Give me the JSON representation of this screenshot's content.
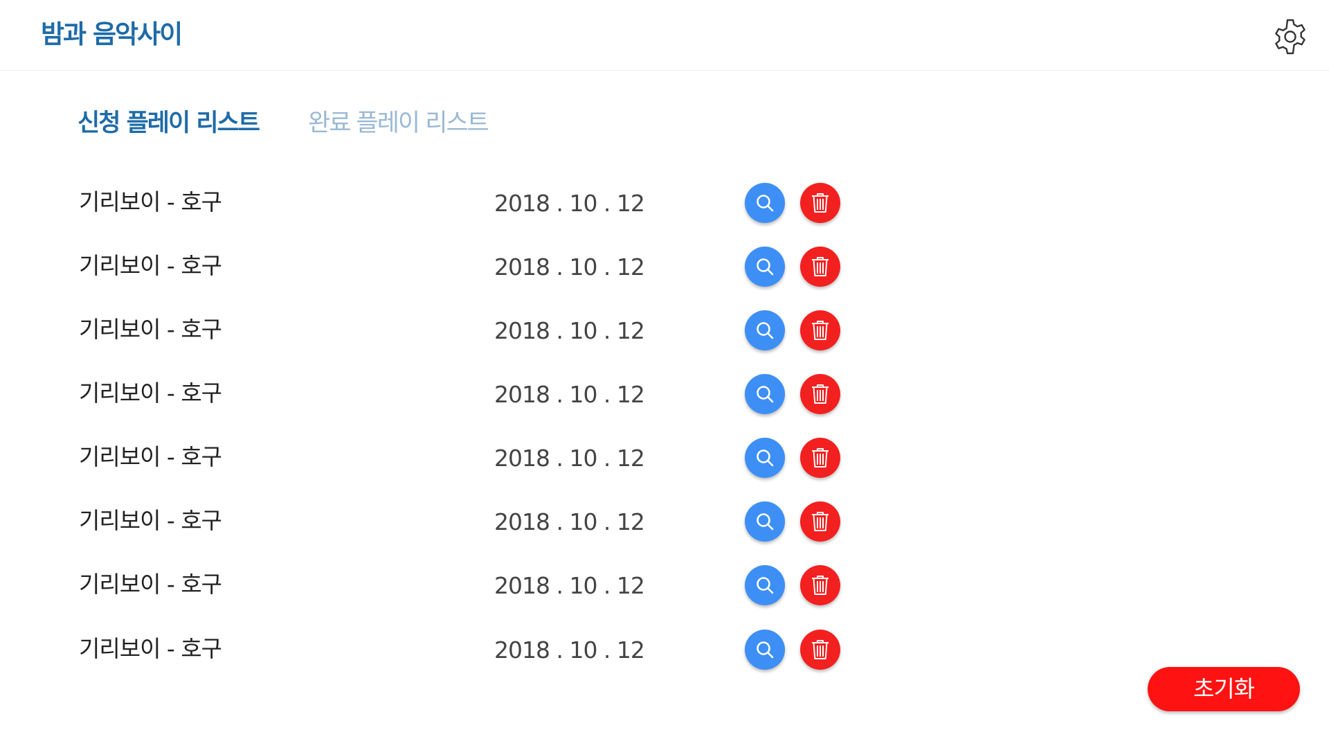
{
  "app": {
    "title": "밤과 음악사이"
  },
  "header": {
    "settings_icon": "gear-icon"
  },
  "tabs": [
    {
      "label": "신청 플레이 리스트",
      "active": true
    },
    {
      "label": "완료 플레이 리스트",
      "active": false
    }
  ],
  "playlist": {
    "items": [
      {
        "song": "기리보이 - 호구",
        "date": "2018 . 10 . 12"
      },
      {
        "song": "기리보이 - 호구",
        "date": "2018 . 10 . 12"
      },
      {
        "song": "기리보이 - 호구",
        "date": "2018 . 10 . 12"
      },
      {
        "song": "기리보이 - 호구",
        "date": "2018 . 10 . 12"
      },
      {
        "song": "기리보이 - 호구",
        "date": "2018 . 10 . 12"
      },
      {
        "song": "기리보이 - 호구",
        "date": "2018 . 10 . 12"
      },
      {
        "song": "기리보이 - 호구",
        "date": "2018 . 10 . 12"
      },
      {
        "song": "기리보이 - 호구",
        "date": "2018 . 10 . 12"
      }
    ],
    "row_icons": {
      "search": "search-icon",
      "delete": "trash-icon"
    }
  },
  "footer": {
    "reset_label": "초기화"
  },
  "colors": {
    "brand": "#1e6ba8",
    "tab_inactive": "#9ab9d4",
    "search_button": "#3d8ff5",
    "delete_button": "#f32020",
    "reset_button": "#ff1212"
  }
}
